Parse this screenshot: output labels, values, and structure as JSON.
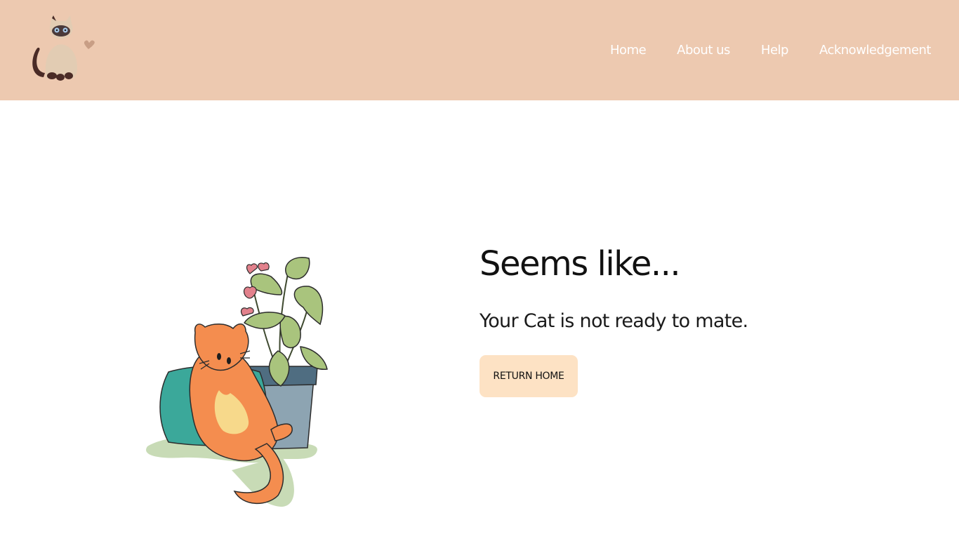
{
  "nav": {
    "items": [
      {
        "label": "Home"
      },
      {
        "label": "About us"
      },
      {
        "label": "Help"
      },
      {
        "label": "Acknowledgement"
      }
    ]
  },
  "main": {
    "title": "Seems like...",
    "message": "Your Cat is not ready to mate.",
    "button_label": "RETURN HOME"
  },
  "colors": {
    "header_bg": "#edc9b0",
    "button_bg": "#fde2c4",
    "nav_text": "#ffffff"
  },
  "icons": {
    "logo": "siamese-cat-with-heart",
    "illustration": "orange-cat-lying-with-plant"
  }
}
